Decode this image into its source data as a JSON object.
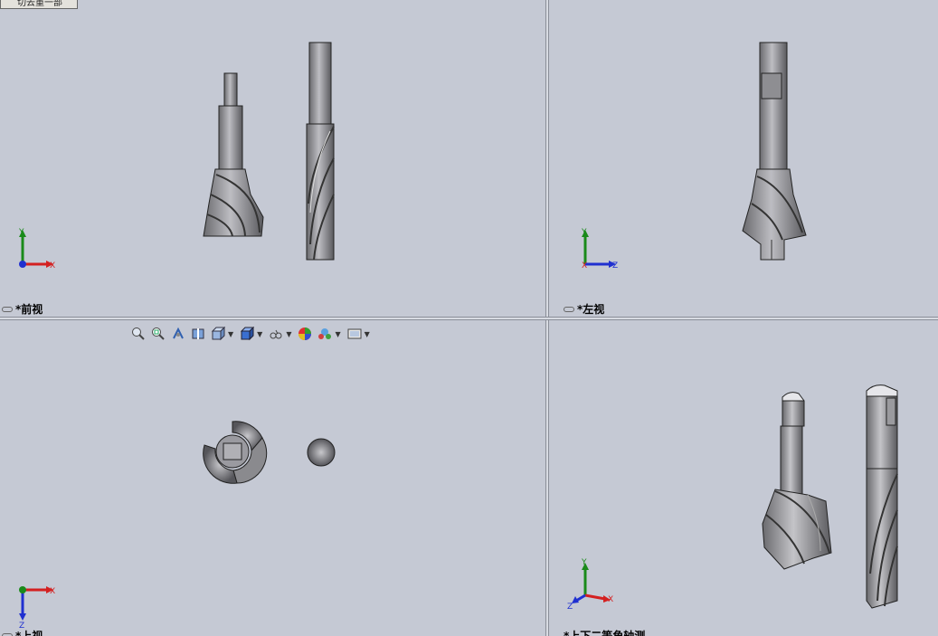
{
  "tab": {
    "label": "切去重一部"
  },
  "viewports": {
    "front": {
      "label": "*前视"
    },
    "left": {
      "label": "*左视"
    },
    "top": {
      "label": "*上视"
    },
    "iso": {
      "label": "*上下二等角轴测"
    }
  },
  "axes": {
    "x": "X",
    "y": "Y",
    "z": "Z"
  },
  "toolbar": {
    "icons": [
      "zoom-to-fit-icon",
      "zoom-to-area-icon",
      "previous-view-icon",
      "section-view-icon",
      "view-orientation-icon",
      "display-style-icon",
      "hide-show-items-icon",
      "edit-appearance-icon",
      "apply-scene-icon",
      "view-settings-icon"
    ]
  },
  "colors": {
    "viewport_bg": "#c5c9d4",
    "x_axis": "#d42020",
    "y_axis": "#1a8a1a",
    "z_axis": "#2030d0"
  }
}
